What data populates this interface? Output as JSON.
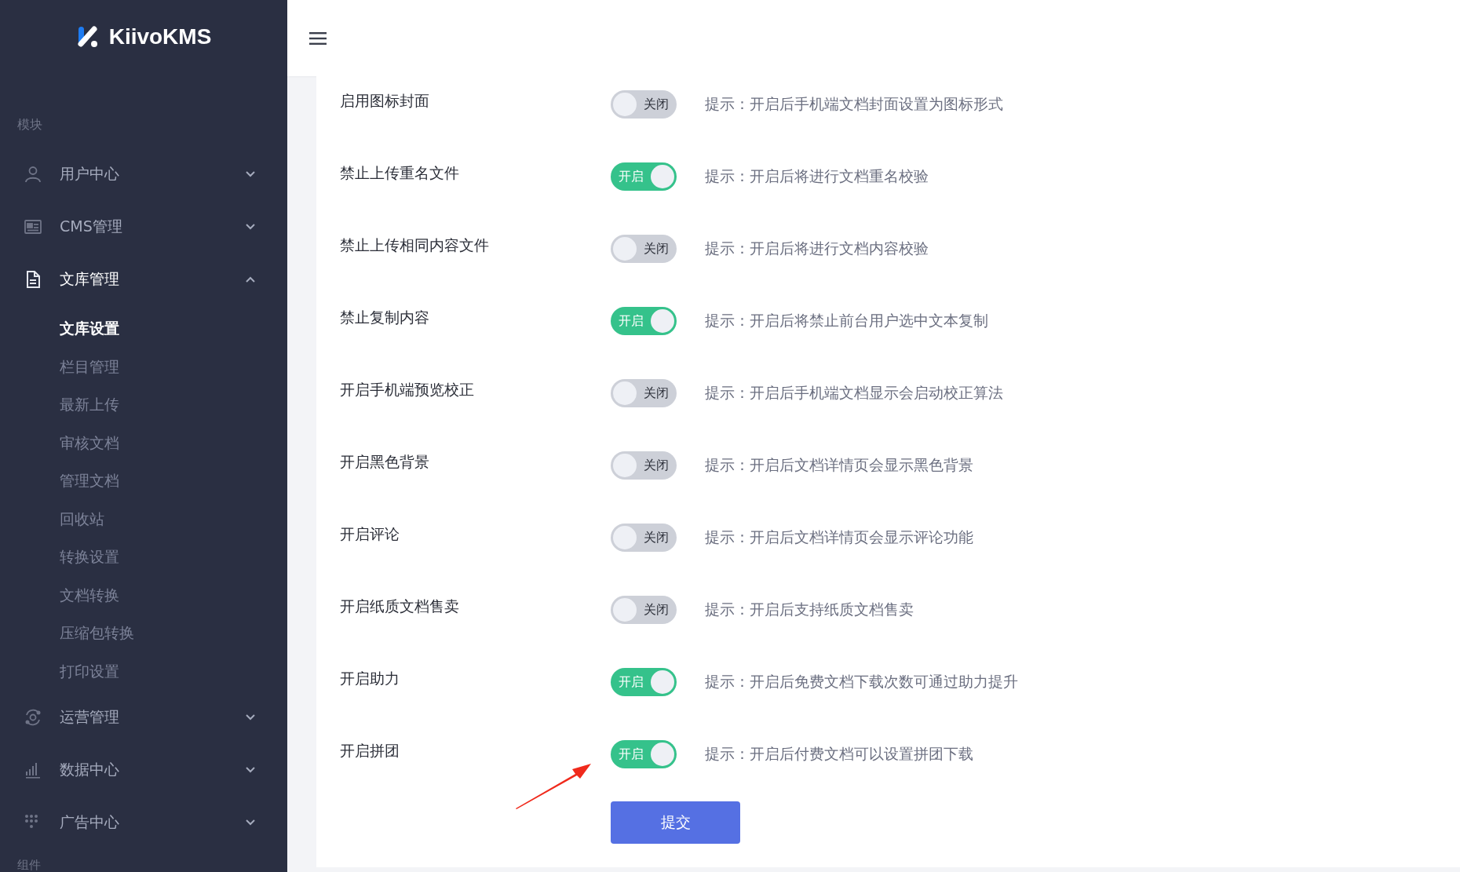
{
  "sidebar": {
    "logo_text": "KiivoKMS",
    "sections": [
      {
        "label": "模块",
        "items": [
          {
            "label": "用户中心",
            "expanded": false
          },
          {
            "label": "CMS管理",
            "expanded": false
          },
          {
            "label": "文库管理",
            "expanded": true,
            "children": [
              {
                "label": "文库设置",
                "selected": true
              },
              {
                "label": "栏目管理",
                "selected": false
              },
              {
                "label": "最新上传",
                "selected": false
              },
              {
                "label": "审核文档",
                "selected": false
              },
              {
                "label": "管理文档",
                "selected": false
              },
              {
                "label": "回收站",
                "selected": false
              },
              {
                "label": "转换设置",
                "selected": false
              },
              {
                "label": "文档转换",
                "selected": false
              },
              {
                "label": "压缩包转换",
                "selected": false
              },
              {
                "label": "打印设置",
                "selected": false
              }
            ]
          },
          {
            "label": "运营管理",
            "expanded": false
          },
          {
            "label": "数据中心",
            "expanded": false
          },
          {
            "label": "广告中心",
            "expanded": false
          }
        ]
      },
      {
        "label": "组件"
      }
    ]
  },
  "settings": [
    {
      "label": "启用图标封面",
      "on": false,
      "switch_text": "关闭",
      "hint": "提示：开启后手机端文档封面设置为图标形式"
    },
    {
      "label": "禁止上传重名文件",
      "on": true,
      "switch_text": "开启",
      "hint": "提示：开启后将进行文档重名校验"
    },
    {
      "label": "禁止上传相同内容文件",
      "on": false,
      "switch_text": "关闭",
      "hint": "提示：开启后将进行文档内容校验"
    },
    {
      "label": "禁止复制内容",
      "on": true,
      "switch_text": "开启",
      "hint": "提示：开启后将禁止前台用户选中文本复制"
    },
    {
      "label": "开启手机端预览校正",
      "on": false,
      "switch_text": "关闭",
      "hint": "提示：开启后手机端文档显示会启动校正算法"
    },
    {
      "label": "开启黑色背景",
      "on": false,
      "switch_text": "关闭",
      "hint": "提示：开启后文档详情页会显示黑色背景"
    },
    {
      "label": "开启评论",
      "on": false,
      "switch_text": "关闭",
      "hint": "提示：开启后文档详情页会显示评论功能"
    },
    {
      "label": "开启纸质文档售卖",
      "on": false,
      "switch_text": "关闭",
      "hint": "提示：开启后支持纸质文档售卖"
    },
    {
      "label": "开启助力",
      "on": true,
      "switch_text": "开启",
      "hint": "提示：开启后免费文档下载次数可通过助力提升"
    },
    {
      "label": "开启拼团",
      "on": true,
      "switch_text": "开启",
      "hint": "提示：开启后付费文档可以设置拼团下载"
    }
  ],
  "submit_button": "提交"
}
